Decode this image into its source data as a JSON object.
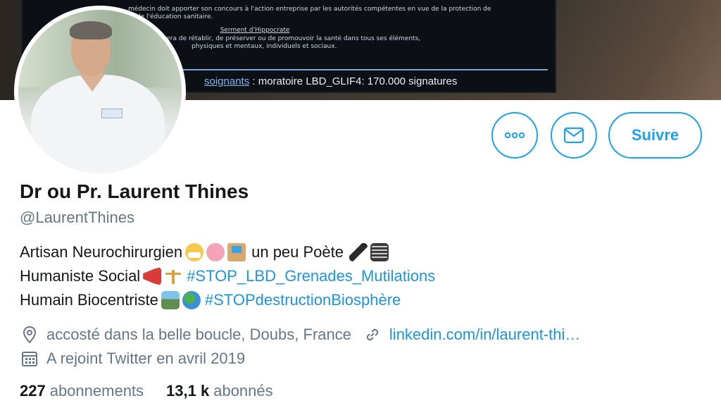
{
  "banner": {
    "line1": "médecin doit apporter son concours à l'action entreprise par les autorités compétentes en vue de la protection de",
    "line2": "et de l'éducation sanitaire.",
    "heading": "Serment d'Hippocrate",
    "line3": "mier souci sera de rétablir, de préserver ou de promouvoir la santé dans tous ses éléments,",
    "line4": "physiques et mentaux, individuels et sociaux.",
    "signature_link": "soignants",
    "signature_text": " : moratoire LBD_GLIF4: 170.000 signatures"
  },
  "actions": {
    "more_icon": "more-icon",
    "mail_icon": "mail-icon",
    "follow_label": "Suivre"
  },
  "profile": {
    "name": "Dr ou Pr. Laurent Thines",
    "handle": "@LaurentThines",
    "bio": {
      "line1_text": "Artisan Neurochirurgien",
      "line1_emojis": [
        "mask-face",
        "brain",
        "hospital"
      ],
      "line1_text2": "un peu Poète",
      "line1_emojis2": [
        "fountain-pen",
        "notebook"
      ],
      "line2_text": "Humaniste Social",
      "line2_emojis": [
        "megaphone",
        "balance-scale"
      ],
      "line2_hashtag": "#STOP_LBD_Grenades_Mutilations",
      "line3_text": "Humain Biocentriste",
      "line3_emojis": [
        "national-park",
        "globe"
      ],
      "line3_hashtag": "#STOPdestructionBiosphère"
    },
    "location": "accosté dans la belle boucle, Doubs, France",
    "website": "linkedin.com/in/laurent-thi…",
    "joined": "A rejoint Twitter en avril 2019"
  },
  "stats": {
    "following_count": "227",
    "following_label": "abonnements",
    "followers_count": "13,1 k",
    "followers_label": "abonnés"
  },
  "colors": {
    "accent": "#1da1f2",
    "link": "#1b95e0",
    "secondary_text": "#657786",
    "primary_text": "#14171a"
  }
}
